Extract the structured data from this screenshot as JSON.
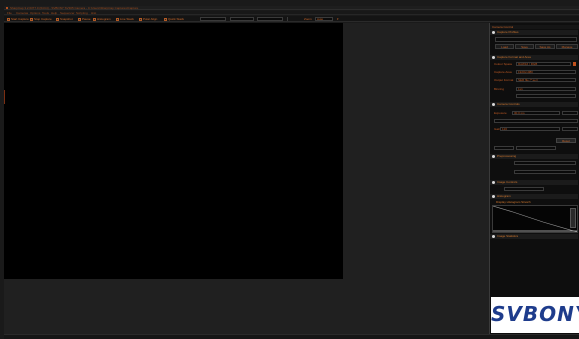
{
  "window": {
    "title": "SharpCap 3.2.6377.0 (64 bit) - SVBONY SV305 Camera - C:\\Users\\SharpCap Captures\\Capture"
  },
  "menu": [
    "File",
    "Cameras",
    "Options",
    "Tools",
    "Help",
    "Sequencer",
    "Scripting",
    "Hist"
  ],
  "toolbar": {
    "buttons": [
      "Start Capture",
      "Stop Capture",
      "Snapshot",
      "Pause",
      "Histogram",
      "Live Stack",
      "Polar Align",
      "Quick Stack"
    ],
    "zoom_label": "Zoom",
    "zoom_value": "Auto"
  },
  "panel": {
    "header": "Camera Control",
    "sections": {
      "capture_profiles": "Capture Profiles",
      "capture_format": "Capture Format and Area",
      "camera_controls": "Camera Controls",
      "preprocessing": "Preprocessing",
      "image_controls": "Image Controls",
      "histogram": "Histogram",
      "image_stats": "Image Statistics"
    },
    "tabs": [
      "Load",
      "Save",
      "Save As",
      "Manage"
    ],
    "format": {
      "colour_space_label": "Colour Space",
      "colour_space_value": "RAW16 / RGB",
      "capture_area_label": "Capture Area",
      "capture_area_value": "1920x1080",
      "output_format_label": "Output Format",
      "output_format_value": "SER file (*.ser)",
      "binning_label": "Binning",
      "binning_value": "1x1"
    },
    "controls": {
      "exposure_label": "Exposure",
      "exposure_value": "30.0 ms",
      "gain_label": "Gain",
      "gain_value": "120",
      "reset_label": "Reset"
    },
    "histogram_chart_title": "Display Histogram Stretch"
  },
  "branding": {
    "logo_text": "SVBONY"
  },
  "colors": {
    "accent": "#c86428",
    "logo": "#1e3c8c",
    "preview": "#000000"
  }
}
